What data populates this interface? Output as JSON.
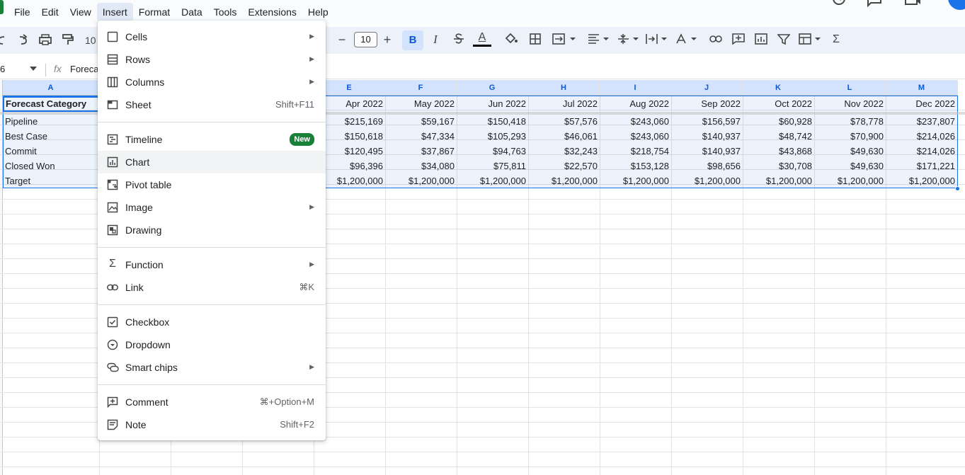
{
  "menubar": [
    "File",
    "Edit",
    "View",
    "Insert",
    "Format",
    "Data",
    "Tools",
    "Extensions",
    "Help"
  ],
  "toolbar": {
    "zoom": "10",
    "font_size": "10",
    "bold": "B",
    "italic": "I",
    "text_color_glyph": "A",
    "sum_glyph": "Σ"
  },
  "formula_bar": {
    "cell_ref": "6",
    "fx": "fx",
    "content": "Forecast"
  },
  "columns": [
    "A",
    "E",
    "F",
    "G",
    "H",
    "I",
    "J",
    "K",
    "L",
    "M"
  ],
  "sheet": {
    "header": [
      "Forecast Category",
      "Apr 2022",
      "May 2022",
      "Jun 2022",
      "Jul 2022",
      "Aug 2022",
      "Sep 2022",
      "Oct 2022",
      "Nov 2022",
      "Dec 2022"
    ],
    "rows": [
      [
        "Pipeline",
        "$215,169",
        "$59,167",
        "$150,418",
        "$57,576",
        "$243,060",
        "$156,597",
        "$60,928",
        "$78,778",
        "$237,807"
      ],
      [
        "Best Case",
        "$150,618",
        "$47,334",
        "$105,293",
        "$46,061",
        "$243,060",
        "$140,937",
        "$48,742",
        "$70,900",
        "$214,026"
      ],
      [
        "Commit",
        "$120,495",
        "$37,867",
        "$94,763",
        "$32,243",
        "$218,754",
        "$140,937",
        "$43,868",
        "$49,630",
        "$214,026"
      ],
      [
        "Closed Won",
        "$96,396",
        "$34,080",
        "$75,811",
        "$22,570",
        "$153,128",
        "$98,656",
        "$30,708",
        "$49,630",
        "$171,221"
      ],
      [
        "Target",
        "$1,200,000",
        "$1,200,000",
        "$1,200,000",
        "$1,200,000",
        "$1,200,000",
        "$1,200,000",
        "$1,200,000",
        "$1,200,000",
        "$1,200,000"
      ]
    ]
  },
  "insert_menu": {
    "items": [
      {
        "label": "Cells",
        "shortcut": "",
        "submenu": true,
        "icon": "cells-icon"
      },
      {
        "label": "Rows",
        "shortcut": "",
        "submenu": true,
        "icon": "rows-icon"
      },
      {
        "label": "Columns",
        "shortcut": "",
        "submenu": true,
        "icon": "columns-icon"
      },
      {
        "label": "Sheet",
        "shortcut": "Shift+F11",
        "submenu": false,
        "icon": "sheet-icon"
      },
      {
        "label": "Timeline",
        "badge": "New",
        "icon": "timeline-icon"
      },
      {
        "label": "Chart",
        "icon": "chart-icon"
      },
      {
        "label": "Pivot table",
        "icon": "pivot-table-icon"
      },
      {
        "label": "Image",
        "submenu": true,
        "icon": "image-icon"
      },
      {
        "label": "Drawing",
        "icon": "drawing-icon"
      },
      {
        "label": "Function",
        "submenu": true,
        "icon": "function-icon"
      },
      {
        "label": "Link",
        "shortcut": "⌘K",
        "icon": "link-icon"
      },
      {
        "label": "Checkbox",
        "icon": "checkbox-icon"
      },
      {
        "label": "Dropdown",
        "icon": "dropdown-icon"
      },
      {
        "label": "Smart chips",
        "submenu": true,
        "icon": "smart-chips-icon"
      },
      {
        "label": "Comment",
        "shortcut": "⌘+Option+M",
        "icon": "comment-icon"
      },
      {
        "label": "Note",
        "shortcut": "Shift+F2",
        "icon": "note-icon"
      }
    ]
  }
}
